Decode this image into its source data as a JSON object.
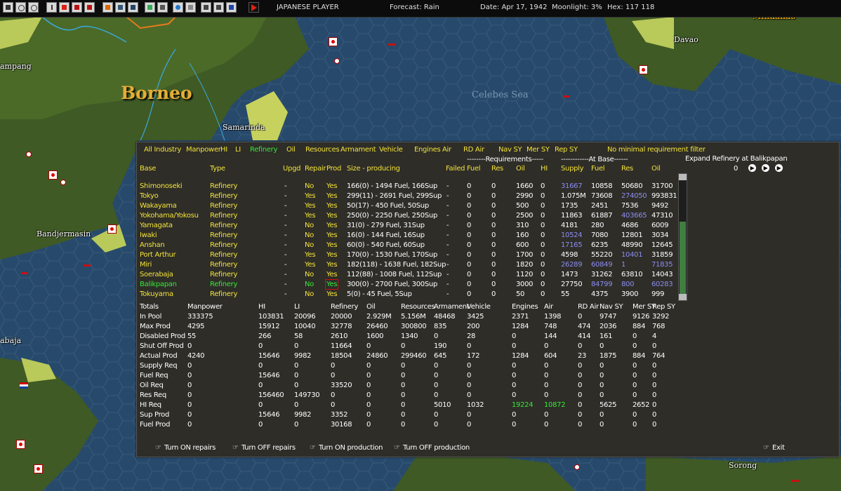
{
  "toolbar": {
    "player": "JAPANESE PLAYER",
    "forecast": "Forecast: Rain",
    "date": "Date: Apr 17, 1942",
    "moonlight": "Moonlight: 3%",
    "hex": "Hex: 117 118"
  },
  "map": {
    "labels": [
      "Borneo",
      "Samarinda",
      "Bandjermasin",
      "Celebes Sea",
      "Davao",
      "Mindanao",
      "ampang",
      "abaja",
      "Sorong"
    ]
  },
  "tabs": [
    "All Industry",
    "Manpower",
    "HI",
    "LI",
    "Refinery",
    "Oil",
    "Resources",
    "Armament",
    "Vehicle",
    "Engines",
    "Air",
    "RD Air",
    "Nav SY",
    "Mer SY",
    "Rep SY",
    "No minimal requirement filter"
  ],
  "active_tab": "Refinery",
  "expand": {
    "label": "Expand Refinery at Balikpapan",
    "value": "0"
  },
  "headers": {
    "requirements": "--------Requirements-----",
    "at_base": "------------At Base------",
    "base": "Base",
    "type": "Type",
    "upgd": "Upgd",
    "repair": "Repair",
    "prod": "Prod",
    "size": "Size - producing",
    "failed": "Failed",
    "fuel": "Fuel",
    "res": "Res",
    "oil": "Oil",
    "hi": "HI",
    "supply": "Supply",
    "fuel2": "Fuel",
    "res2": "Res",
    "oil2": "Oil"
  },
  "rows": [
    {
      "base": "Shimonoseki",
      "type": "Refinery",
      "upgd": "-",
      "repair": "No",
      "prod": "Yes",
      "size": "166(0) - 1494 Fuel, 166Sup",
      "failed": "-",
      "rfuel": "0",
      "rres": "0",
      "roil": "1660",
      "rhi": "0",
      "supply": "31667",
      "fuel": "10858",
      "res": "50680",
      "oil": "31700",
      "supply_blue": true,
      "fuel_blue": false,
      "res_blue": false,
      "oil_blue": false
    },
    {
      "base": "Tokyo",
      "type": "Refinery",
      "upgd": "-",
      "repair": "Yes",
      "prod": "Yes",
      "size": "299(11) - 2691 Fuel, 299Sup",
      "failed": "-",
      "rfuel": "0",
      "rres": "0",
      "roil": "2990",
      "rhi": "0",
      "supply": "1.075M",
      "fuel": "73608",
      "res": "274050",
      "oil": "993831",
      "supply_blue": false,
      "fuel_blue": false,
      "res_blue": true,
      "oil_blue": false
    },
    {
      "base": "Wakayama",
      "type": "Refinery",
      "upgd": "-",
      "repair": "Yes",
      "prod": "Yes",
      "size": "50(17) - 450 Fuel, 50Sup",
      "failed": "-",
      "rfuel": "0",
      "rres": "0",
      "roil": "500",
      "rhi": "0",
      "supply": "1735",
      "fuel": "2451",
      "res": "7536",
      "oil": "9492",
      "supply_blue": false,
      "fuel_blue": false,
      "res_blue": false,
      "oil_blue": false
    },
    {
      "base": "Yokohama/Yokosu",
      "type": "Refinery",
      "upgd": "-",
      "repair": "Yes",
      "prod": "Yes",
      "size": "250(0) - 2250 Fuel, 250Sup",
      "failed": "-",
      "rfuel": "0",
      "rres": "0",
      "roil": "2500",
      "rhi": "0",
      "supply": "11863",
      "fuel": "61887",
      "res": "403665",
      "oil": "47310",
      "supply_blue": false,
      "fuel_blue": false,
      "res_blue": true,
      "oil_blue": false
    },
    {
      "base": "Yamagata",
      "type": "Refinery",
      "upgd": "-",
      "repair": "No",
      "prod": "Yes",
      "size": "31(0) - 279 Fuel, 31Sup",
      "failed": "-",
      "rfuel": "0",
      "rres": "0",
      "roil": "310",
      "rhi": "0",
      "supply": "4181",
      "fuel": "280",
      "res": "4686",
      "oil": "6009",
      "supply_blue": false,
      "fuel_blue": false,
      "res_blue": false,
      "oil_blue": false
    },
    {
      "base": "Iwaki",
      "type": "Refinery",
      "upgd": "-",
      "repair": "No",
      "prod": "Yes",
      "size": "16(0) - 144 Fuel, 16Sup",
      "failed": "-",
      "rfuel": "0",
      "rres": "0",
      "roil": "160",
      "rhi": "0",
      "supply": "10524",
      "fuel": "7080",
      "res": "12801",
      "oil": "3034",
      "supply_blue": true,
      "fuel_blue": false,
      "res_blue": false,
      "oil_blue": false
    },
    {
      "base": "Anshan",
      "type": "Refinery",
      "upgd": "-",
      "repair": "No",
      "prod": "Yes",
      "size": "60(0) - 540 Fuel, 60Sup",
      "failed": "-",
      "rfuel": "0",
      "rres": "0",
      "roil": "600",
      "rhi": "0",
      "supply": "17165",
      "fuel": "6235",
      "res": "48990",
      "oil": "12645",
      "supply_blue": true,
      "fuel_blue": false,
      "res_blue": false,
      "oil_blue": false
    },
    {
      "base": "Port Arthur",
      "type": "Refinery",
      "upgd": "-",
      "repair": "Yes",
      "prod": "Yes",
      "size": "170(0) - 1530 Fuel, 170Sup",
      "failed": "-",
      "rfuel": "0",
      "rres": "0",
      "roil": "1700",
      "rhi": "0",
      "supply": "4598",
      "fuel": "55220",
      "res": "10401",
      "oil": "31859",
      "supply_blue": false,
      "fuel_blue": false,
      "res_blue": true,
      "oil_blue": false
    },
    {
      "base": "Miri",
      "type": "Refinery",
      "upgd": "-",
      "repair": "Yes",
      "prod": "Yes",
      "size": "182(118) - 1638 Fuel, 182Sup",
      "failed": "-",
      "rfuel": "0",
      "rres": "0",
      "roil": "1820",
      "rhi": "0",
      "supply": "26289",
      "fuel": "60849",
      "res": "1",
      "oil": "71835",
      "supply_blue": true,
      "fuel_blue": true,
      "res_blue": true,
      "oil_blue": true
    },
    {
      "base": "Soerabaja",
      "type": "Refinery",
      "upgd": "-",
      "repair": "No",
      "prod": "Yes",
      "size": "112(88) - 1008 Fuel, 112Sup",
      "failed": "-",
      "rfuel": "0",
      "rres": "0",
      "roil": "1120",
      "rhi": "0",
      "supply": "1473",
      "fuel": "31262",
      "res": "63810",
      "oil": "14043",
      "supply_blue": false,
      "fuel_blue": false,
      "res_blue": false,
      "oil_blue": false
    },
    {
      "base": "Balikpapan",
      "type": "Refinery",
      "upgd": "-",
      "repair": "No",
      "prod": "Yes",
      "size": "300(0) - 2700 Fuel, 300Sup",
      "failed": "-",
      "rfuel": "0",
      "rres": "0",
      "roil": "3000",
      "rhi": "0",
      "supply": "27750",
      "fuel": "84799",
      "res": "800",
      "oil": "60283",
      "supply_blue": false,
      "fuel_blue": true,
      "res_blue": true,
      "oil_blue": true,
      "selected": true
    },
    {
      "base": "Tokuyama",
      "type": "Refinery",
      "upgd": "-",
      "repair": "No",
      "prod": "Yes",
      "size": "5(0) - 45 Fuel, 5Sup",
      "failed": "-",
      "rfuel": "0",
      "rres": "0",
      "roil": "50",
      "rhi": "0",
      "supply": "55",
      "fuel": "4375",
      "res": "3900",
      "oil": "999",
      "supply_blue": false,
      "fuel_blue": false,
      "res_blue": false,
      "oil_blue": false
    }
  ],
  "totals": {
    "header": [
      "Totals",
      "Manpower",
      "HI",
      "LI",
      "Refinery",
      "Oil",
      "Resources",
      "Armament",
      "Vehicle",
      "Engines",
      "Air",
      "RD Air",
      "Nav SY",
      "Mer SY",
      "Rep SY"
    ],
    "rows": [
      [
        "In Pool",
        "333375",
        "103831",
        "20096",
        "20000",
        "2.929M",
        "5.156M",
        "48468",
        "3425",
        "2371",
        "1398",
        "0",
        "9747",
        "9126",
        "3292"
      ],
      [
        "Max Prod",
        "4295",
        "15912",
        "10040",
        "32778",
        "26460",
        "300800",
        "835",
        "200",
        "1284",
        "748",
        "474",
        "2036",
        "884",
        "768"
      ],
      [
        "Disabled Prod",
        "55",
        "266",
        "58",
        "2610",
        "1600",
        "1340",
        "0",
        "28",
        "0",
        "144",
        "414",
        "161",
        "0",
        "4"
      ],
      [
        "Shut Off Prod",
        "0",
        "0",
        "0",
        "11664",
        "0",
        "0",
        "190",
        "0",
        "0",
        "0",
        "0",
        "0",
        "0",
        "0"
      ],
      [
        "Actual Prod",
        "4240",
        "15646",
        "9982",
        "18504",
        "24860",
        "299460",
        "645",
        "172",
        "1284",
        "604",
        "23",
        "1875",
        "884",
        "764"
      ],
      [
        "Supply Req",
        "0",
        "0",
        "0",
        "0",
        "0",
        "0",
        "0",
        "0",
        "0",
        "0",
        "0",
        "0",
        "0",
        "0"
      ],
      [
        "Fuel Req",
        "0",
        "15646",
        "0",
        "0",
        "0",
        "0",
        "0",
        "0",
        "0",
        "0",
        "0",
        "0",
        "0",
        "0"
      ],
      [
        "Oil Req",
        "0",
        "0",
        "0",
        "33520",
        "0",
        "0",
        "0",
        "0",
        "0",
        "0",
        "0",
        "0",
        "0",
        "0"
      ],
      [
        "Res Req",
        "0",
        "156460",
        "149730",
        "0",
        "0",
        "0",
        "0",
        "0",
        "0",
        "0",
        "0",
        "0",
        "0",
        "0"
      ],
      [
        "HI Req",
        "0",
        "0",
        "0",
        "0",
        "0",
        "0",
        "5010",
        "1032",
        "19224",
        "10872",
        "0",
        "5625",
        "2652",
        "0"
      ],
      [
        "Sup Prod",
        "0",
        "15646",
        "9982",
        "3352",
        "0",
        "0",
        "0",
        "0",
        "0",
        "0",
        "0",
        "0",
        "0",
        "0"
      ],
      [
        "Fuel Prod",
        "0",
        "0",
        "0",
        "30168",
        "0",
        "0",
        "0",
        "0",
        "0",
        "0",
        "0",
        "0",
        "0",
        "0"
      ]
    ],
    "green_cells": [
      [
        9,
        9
      ],
      [
        9,
        10
      ]
    ]
  },
  "actions": {
    "repairs_on": "Turn ON repairs",
    "repairs_off": "Turn OFF repairs",
    "prod_on": "Turn ON production",
    "prod_off": "Turn OFF production",
    "exit": "Exit"
  },
  "colors": {
    "panel_bg": "#2e2d28",
    "text_yellow": "#f2e23a",
    "text_green": "#37e837",
    "text_blue": "#8c8cf0"
  }
}
